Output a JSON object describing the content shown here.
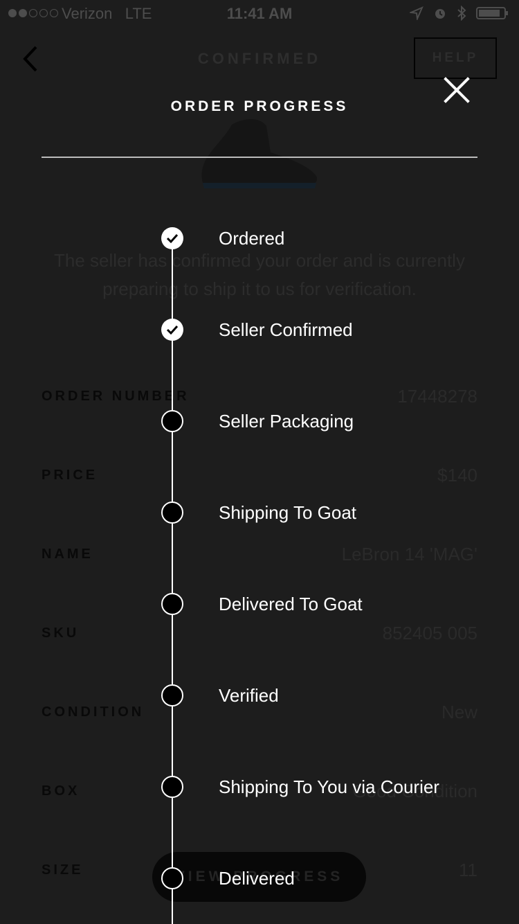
{
  "status_bar": {
    "carrier": "Verizon",
    "network": "LTE",
    "time": "11:41 AM"
  },
  "header": {
    "title": "CONFIRMED",
    "help_label": "HELP"
  },
  "order": {
    "description": "The seller has confirmed your order and is currently preparing to ship it to us for verification.",
    "details": [
      {
        "label": "ORDER NUMBER",
        "value": "17448278"
      },
      {
        "label": "PRICE",
        "value": "$140"
      },
      {
        "label": "NAME",
        "value": "LeBron 14 'MAG'"
      },
      {
        "label": "SKU",
        "value": "852405 005"
      },
      {
        "label": "CONDITION",
        "value": "New"
      },
      {
        "label": "BOX",
        "value": "Good Condition"
      },
      {
        "label": "SIZE",
        "value": "11"
      }
    ],
    "view_progress_label": "VIEW PROGRESS"
  },
  "overlay": {
    "title": "ORDER PROGRESS",
    "steps": [
      {
        "label": "Ordered",
        "completed": true
      },
      {
        "label": "Seller Confirmed",
        "completed": true
      },
      {
        "label": "Seller Packaging",
        "completed": false
      },
      {
        "label": "Shipping To Goat",
        "completed": false
      },
      {
        "label": "Delivered To Goat",
        "completed": false
      },
      {
        "label": "Verified",
        "completed": false
      },
      {
        "label": "Shipping To You via Courier",
        "completed": false
      },
      {
        "label": "Delivered",
        "completed": false
      }
    ]
  },
  "colors": {
    "overlay_background": "#1d1d1d",
    "overlay_text": "#ffffff",
    "dimmed_text": "#2a2a2a"
  }
}
